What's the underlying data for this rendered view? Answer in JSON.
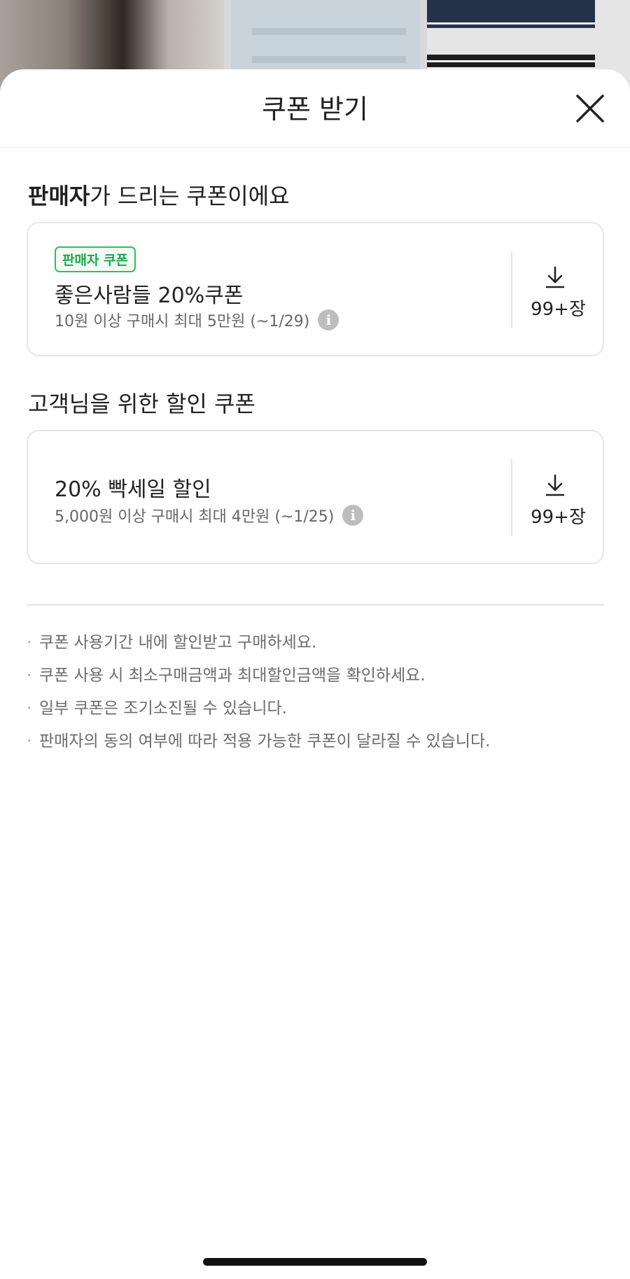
{
  "sheet": {
    "title": "쿠폰 받기",
    "close_icon": "close-icon"
  },
  "seller_section": {
    "heading_bold": "판매자",
    "heading_rest": "가 드리는 쿠폰이에요",
    "coupons": [
      {
        "badge": "판매자 쿠폰",
        "name": "좋은사람들 20%쿠폰",
        "condition": "10원 이상 구매시 최대 5만원 (~1/29)",
        "count": "99+장"
      }
    ]
  },
  "customer_section": {
    "heading": "고객님을 위한 할인 쿠폰",
    "coupons": [
      {
        "name": "20% 빡세일 할인",
        "condition": "5,000원 이상 구매시 최대 4만원 (~1/25)",
        "count": "99+장"
      }
    ]
  },
  "notes": [
    "쿠폰 사용기간 내에 할인받고 구매하세요.",
    "쿠폰 사용 시 최소구매금액과 최대할인금액을 확인하세요.",
    "일부 쿠폰은 조기소진될 수 있습니다.",
    "판매자의 동의 여부에 따라 적용 가능한 쿠폰이 달라질 수 있습니다."
  ],
  "colors": {
    "badge_green": "#2ac25b",
    "text_primary": "#222222",
    "text_secondary": "#666666"
  }
}
